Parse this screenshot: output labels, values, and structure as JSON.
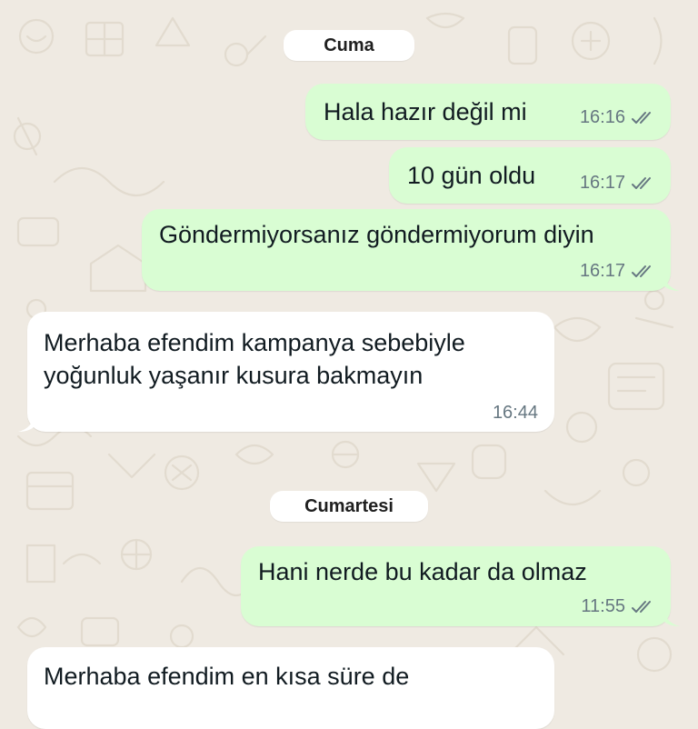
{
  "theme": {
    "background": "#efeae2",
    "outgoing_bubble": "#d9fdd3",
    "incoming_bubble": "#ffffff",
    "meta_color": "#667781",
    "text_color": "#111b21"
  },
  "chat": {
    "date_separators": [
      "Cuma",
      "Cumartesi"
    ],
    "messages": [
      {
        "direction": "out",
        "text": "Hala hazır değil mi",
        "time": "16:16",
        "status_icon": "double-check-icon"
      },
      {
        "direction": "out",
        "text": "10 gün oldu",
        "time": "16:17",
        "status_icon": "double-check-icon"
      },
      {
        "direction": "out",
        "text": "Göndermiyorsanız göndermiyorum diyin",
        "time": "16:17",
        "status_icon": "double-check-icon"
      },
      {
        "direction": "in",
        "lines": [
          "Merhaba efendim kampanya sebebiyle",
          "yoğunluk yaşanır kusura bakmayın"
        ],
        "time": "16:44"
      },
      {
        "direction": "out",
        "text": "Hani nerde bu kadar da olmaz",
        "time": "11:55",
        "status_icon": "double-check-icon"
      },
      {
        "direction": "in",
        "lines": [
          "Merhaba efendim en kısa süre de"
        ]
      }
    ]
  }
}
